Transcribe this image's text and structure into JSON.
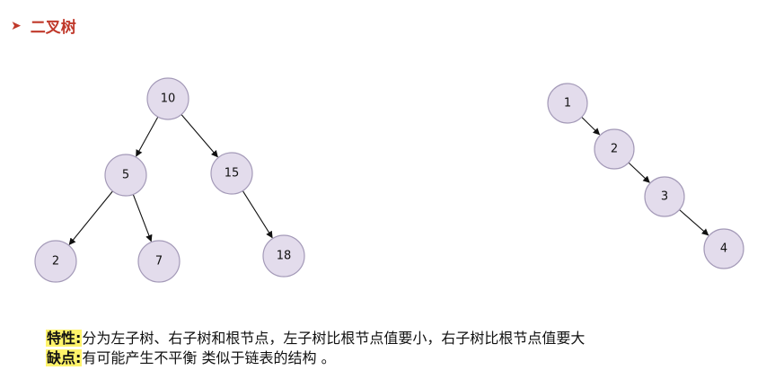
{
  "header": {
    "bullet": "➤",
    "title": "二叉树"
  },
  "trees": [
    {
      "id": "balanced",
      "nodes": [
        {
          "id": "n10",
          "label": "10"
        },
        {
          "id": "n5",
          "label": "5"
        },
        {
          "id": "n15",
          "label": "15"
        },
        {
          "id": "n2",
          "label": "2"
        },
        {
          "id": "n7",
          "label": "7"
        },
        {
          "id": "n18",
          "label": "18"
        }
      ],
      "edges": [
        [
          "n10",
          "n5"
        ],
        [
          "n10",
          "n15"
        ],
        [
          "n5",
          "n2"
        ],
        [
          "n5",
          "n7"
        ],
        [
          "n15",
          "n18"
        ]
      ]
    },
    {
      "id": "skewed",
      "nodes": [
        {
          "id": "m1",
          "label": "1"
        },
        {
          "id": "m2",
          "label": "2"
        },
        {
          "id": "m3",
          "label": "3"
        },
        {
          "id": "m4",
          "label": "4"
        }
      ],
      "edges": [
        [
          "m1",
          "m2"
        ],
        [
          "m2",
          "m3"
        ],
        [
          "m3",
          "m4"
        ]
      ]
    }
  ],
  "notes": {
    "properties_label": "特性:",
    "properties_text": "分为左子树、右子树和根节点，左子树比根节点值要小，右子树比根节点值要大",
    "drawback_label": "缺点:",
    "drawback_text": "有可能产生不平衡 类似于链表的结构 。"
  },
  "colors": {
    "title": "#c0392b",
    "node_fill": "#e3dcec",
    "node_stroke": "#a49ab8",
    "highlight": "#fff36a"
  }
}
